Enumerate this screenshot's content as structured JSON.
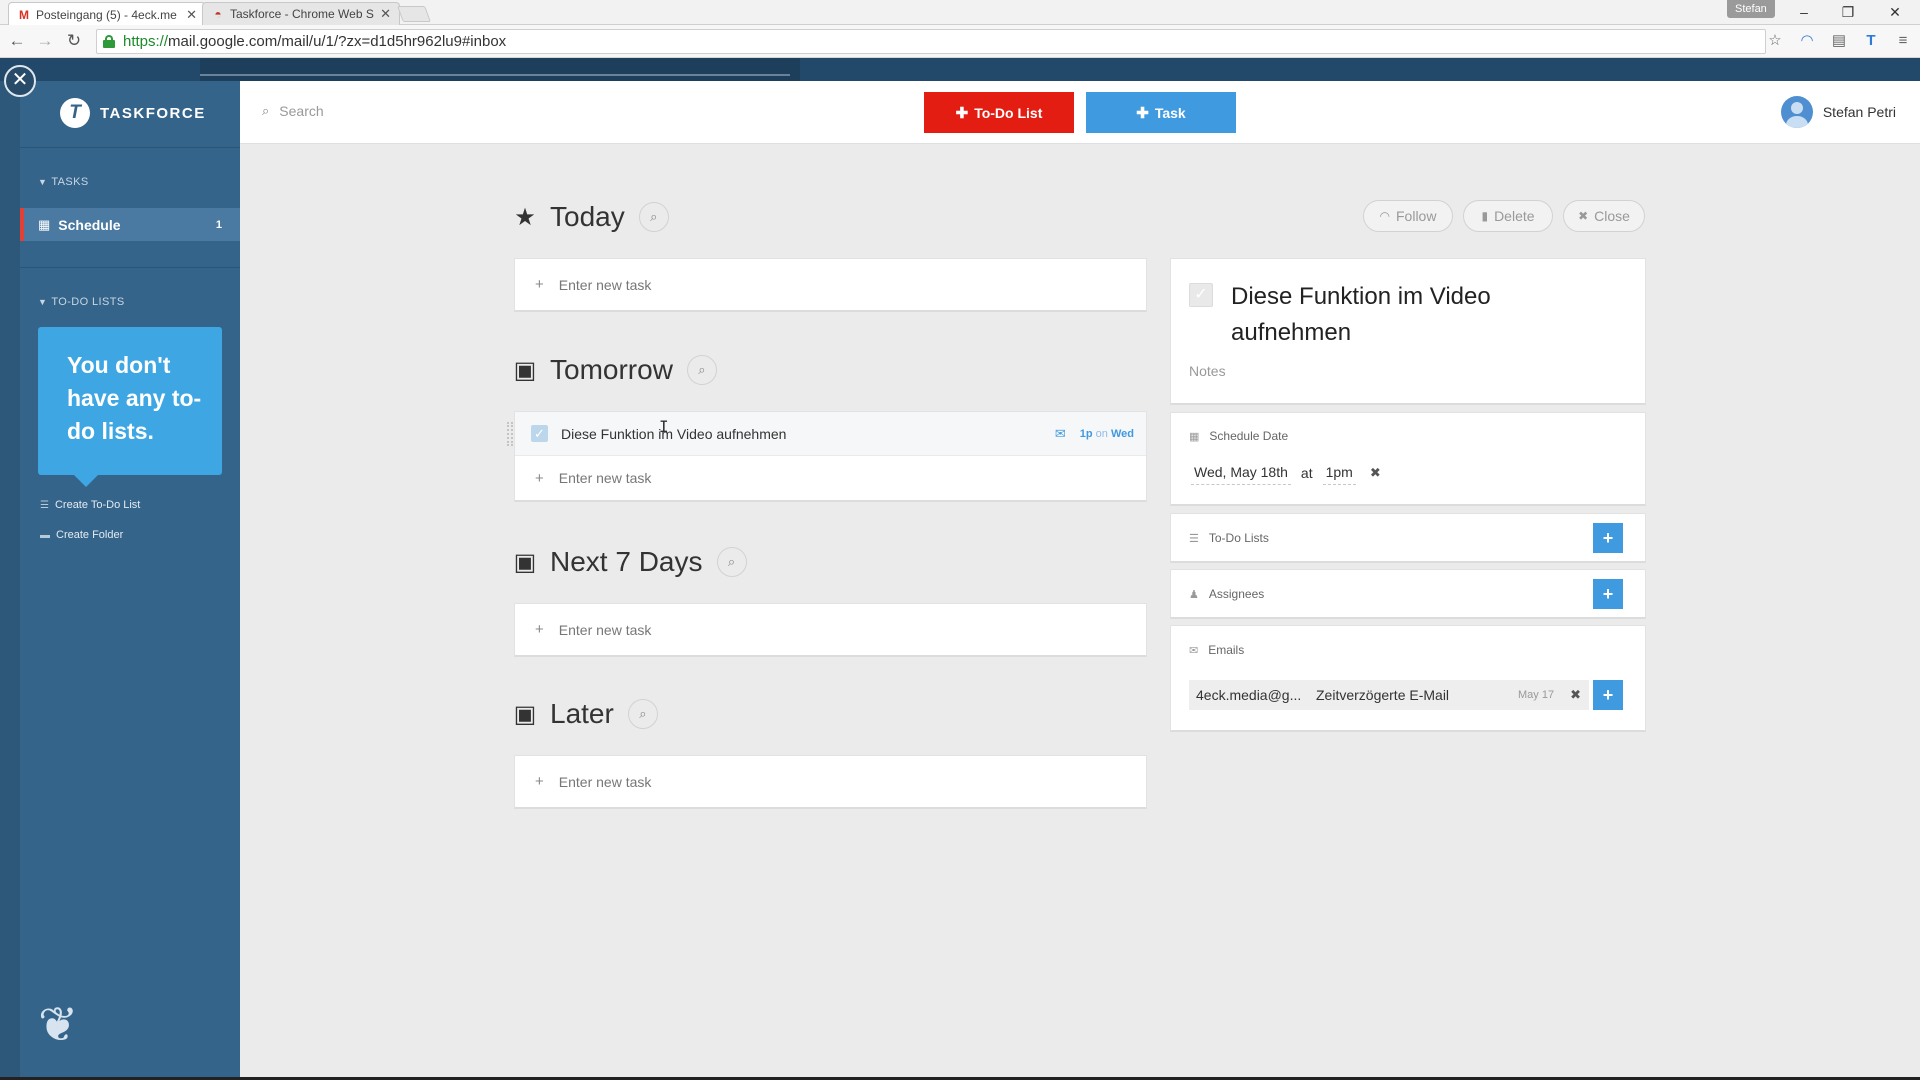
{
  "browser": {
    "tabs": [
      {
        "title": "Posteingang (5) - 4eck.me",
        "icon": "gmail-icon"
      },
      {
        "title": "Taskforce - Chrome Web S",
        "icon": "chrome-web-store-icon"
      }
    ],
    "profile_badge": "Stefan",
    "url_secure": "https://",
    "url_rest": "mail.google.com/mail/u/1/?zx=d1d5hr962lu9#inbox"
  },
  "sidebar": {
    "brand": "TASKFORCE",
    "tasks_header": "TASKS",
    "schedule_label": "Schedule",
    "schedule_count": "1",
    "todo_header": "TO-DO LISTS",
    "empty_tip": "You don't have any to-do lists.",
    "links": [
      "Create To-Do List",
      "Create Folder"
    ]
  },
  "appbar": {
    "search_placeholder": "Search",
    "todo_button": "To-Do List",
    "task_button": "Task",
    "user_name": "Stefan Petri"
  },
  "sections": {
    "today": {
      "title": "Today",
      "new_task": "Enter new task"
    },
    "tomorrow": {
      "title": "Tomorrow",
      "task": {
        "title": "Diese Funktion im Video aufnehmen",
        "time": "1p",
        "on": "on",
        "day": "Wed"
      },
      "new_task": "Enter new task"
    },
    "next7": {
      "title": "Next 7 Days",
      "new_task": "Enter new task"
    },
    "later": {
      "title": "Later",
      "new_task": "Enter new task"
    }
  },
  "detail": {
    "actions": {
      "follow": "Follow",
      "delete": "Delete",
      "close": "Close"
    },
    "title": "Diese Funktion im Video aufnehmen",
    "notes_placeholder": "Notes",
    "schedule_label": "Schedule Date",
    "schedule_date": "Wed, May 18th",
    "schedule_at": "at",
    "schedule_time": "1pm",
    "todo_lists_label": "To-Do Lists",
    "assignees_label": "Assignees",
    "emails_label": "Emails",
    "email": {
      "from": "4eck.media@g...",
      "subject": "Zeitverzögerte E-Mail",
      "date": "May 17"
    }
  },
  "colors": {
    "sidebar": "#35648a",
    "accent_red": "#e41d12",
    "accent_blue": "#3f9ae0",
    "tip_blue": "#3ea6e3"
  }
}
